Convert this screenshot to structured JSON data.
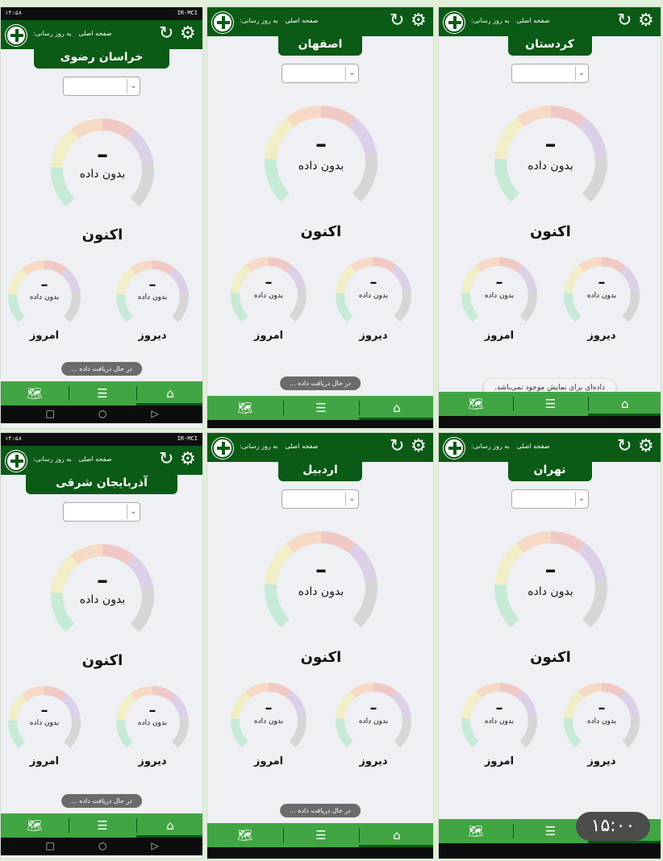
{
  "status_left": "۱۴:۵۸",
  "status_right": "IR-MCI",
  "breadcrumb_home": "صفحه اصلی",
  "breadcrumb_updated": "به روز رسانی:",
  "gauge_value": "–",
  "gauge_no_data": "بدون داده",
  "label_now": "اکنون",
  "label_today": "امروز",
  "label_yesterday": "دیروز",
  "toast_loading": "در حال دریافت داده ...",
  "toast_no_data": "داده‌ای برای نمایش موجود نمی‌باشد.",
  "clock": "۱۵:۰۰",
  "colors": {
    "appbar": "#0b5a16",
    "bottomnav": "#41a544",
    "gauge_green": "#c6ead6",
    "gauge_yellow": "#f1eec8",
    "gauge_orange": "#f6dac5",
    "gauge_red": "#f0c9c6",
    "gauge_purple": "#dcd0e8",
    "gauge_gray": "#d6d6d6"
  },
  "panels": [
    {
      "region": "خراسان رضوی",
      "toast_type": "loading"
    },
    {
      "region": "اصفهان",
      "toast_type": "loading"
    },
    {
      "region": "کردستان",
      "toast_type": "no_data"
    },
    {
      "region": "آذربایجان شرقی",
      "toast_type": "loading"
    },
    {
      "region": "اردبیل",
      "toast_type": "loading"
    },
    {
      "region": "تهران",
      "toast_type": "none"
    }
  ],
  "icons": {
    "logo": "logo-icon",
    "refresh": "refresh-icon",
    "gear": "gear-icon",
    "map": "map-icon",
    "list": "list-sort-icon",
    "home": "home-icon"
  }
}
